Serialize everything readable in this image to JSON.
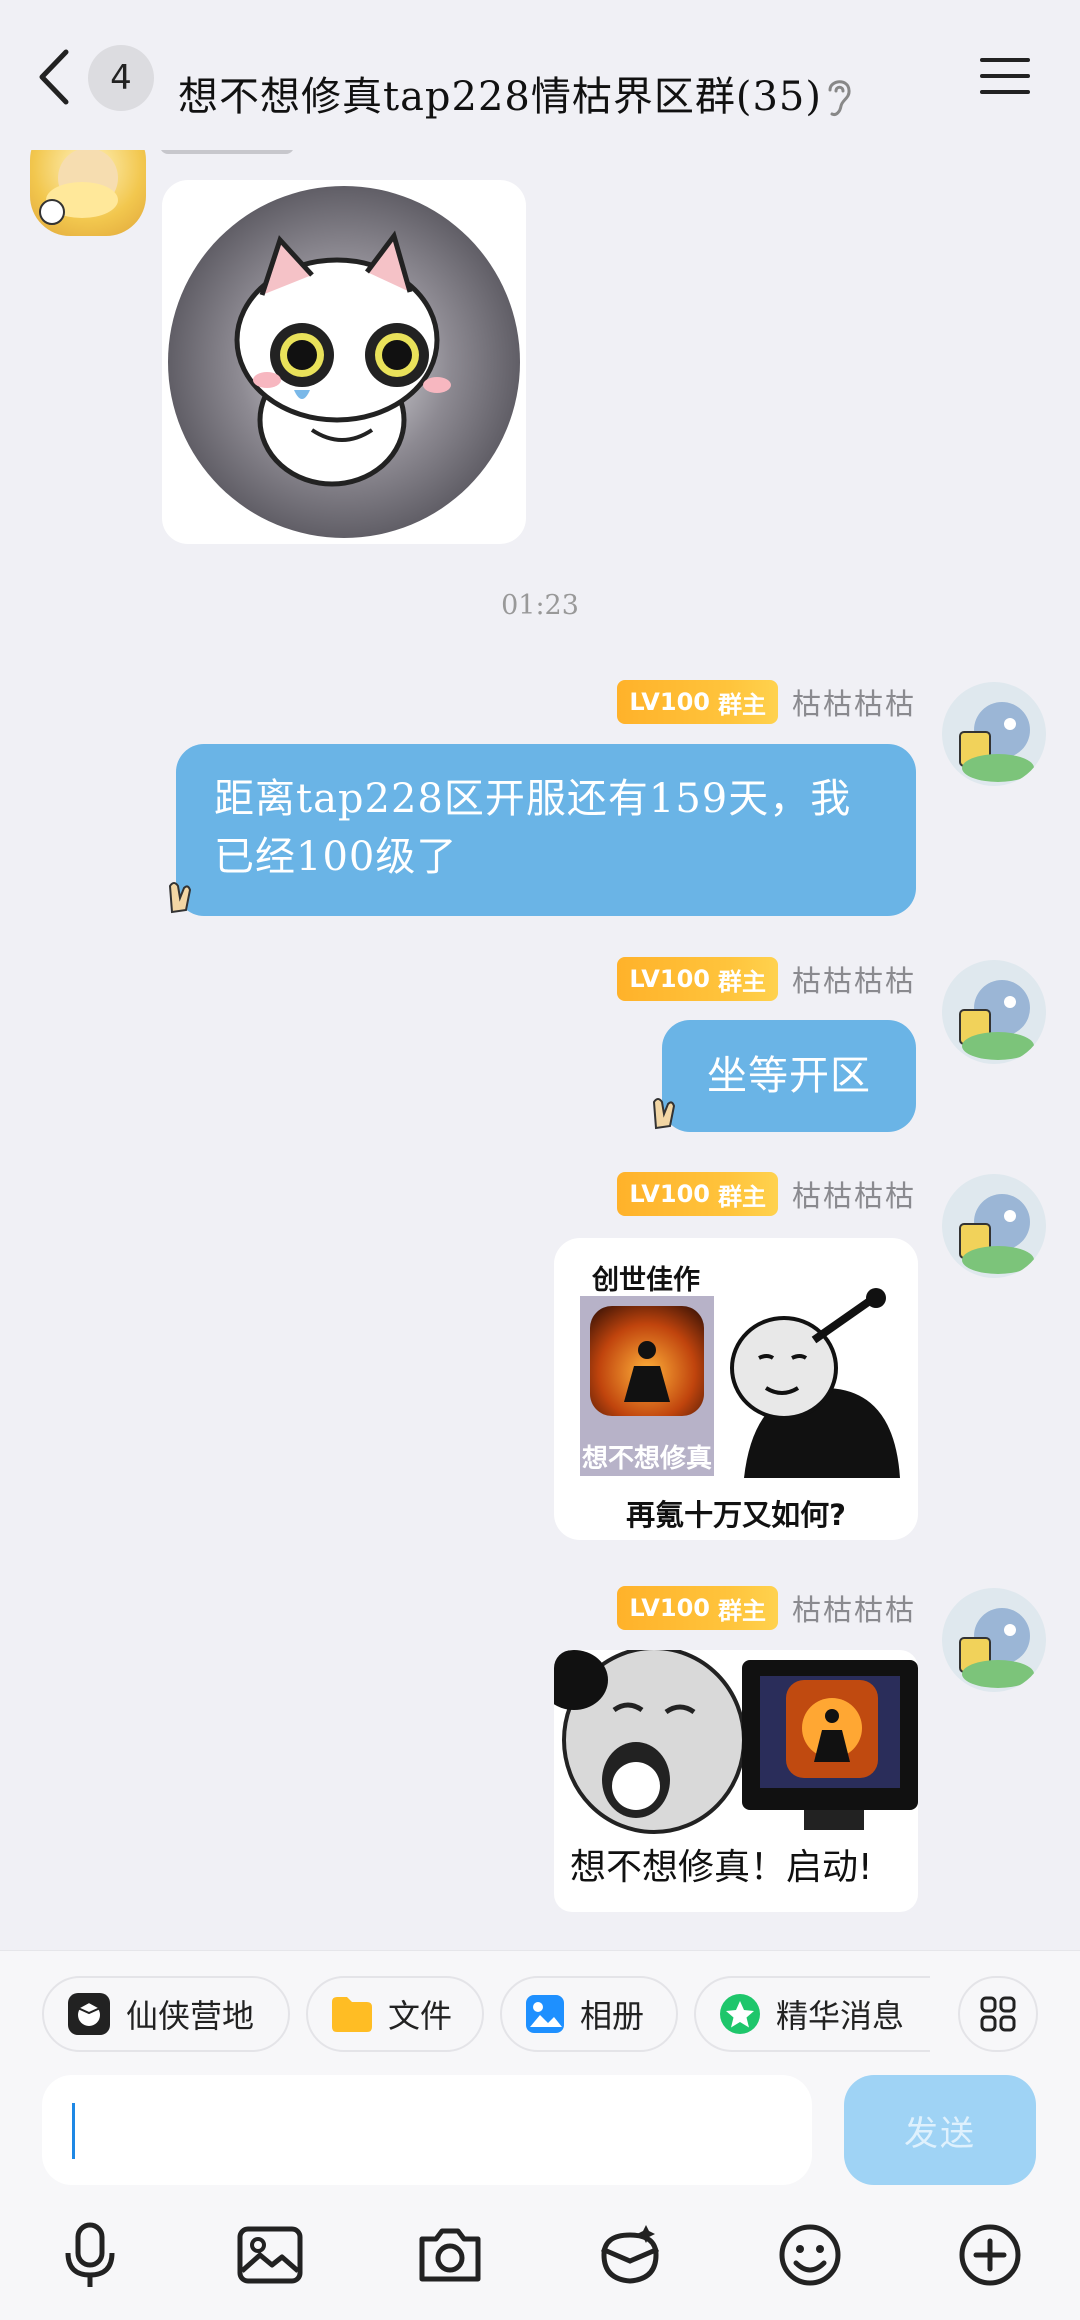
{
  "header": {
    "unread_count": "4",
    "title": "想不想修真tap228情枯界区群(35)"
  },
  "timestamp": "01:23",
  "messages": [
    {
      "badge_level": "LV100",
      "badge_role": "群主",
      "sender": "枯枯枯枯",
      "text_line1": "距离tap228区开服还有159天，我",
      "text_line2": "已经100级了"
    },
    {
      "badge_level": "LV100",
      "badge_role": "群主",
      "sender": "枯枯枯枯",
      "text": "坐等开区"
    },
    {
      "badge_level": "LV100",
      "badge_role": "群主",
      "sender": "枯枯枯枯",
      "sticker_top": "创世佳作",
      "sticker_app": "想不想修真",
      "sticker_bottom": "再氪十万又如何?"
    },
    {
      "badge_level": "LV100",
      "badge_role": "群主",
      "sender": "枯枯枯枯",
      "sticker_caption": "想不想修真！启动!"
    }
  ],
  "shortcuts": [
    {
      "label": "仙侠营地",
      "icon": "camp-icon"
    },
    {
      "label": "文件",
      "icon": "folder-icon"
    },
    {
      "label": "相册",
      "icon": "album-icon"
    },
    {
      "label": "精华消息",
      "icon": "star-icon"
    },
    {
      "label": "",
      "icon": "grid-icon"
    }
  ],
  "input": {
    "value": "",
    "send_label": "发送"
  },
  "toolbar": [
    "mic-icon",
    "image-icon",
    "camera-icon",
    "red-packet-icon",
    "emoji-icon",
    "plus-icon"
  ],
  "colors": {
    "bubble": "#6ab4e6",
    "badge": "#ffb22a",
    "send": "#9fd3f5",
    "background": "#f0f0f5"
  }
}
